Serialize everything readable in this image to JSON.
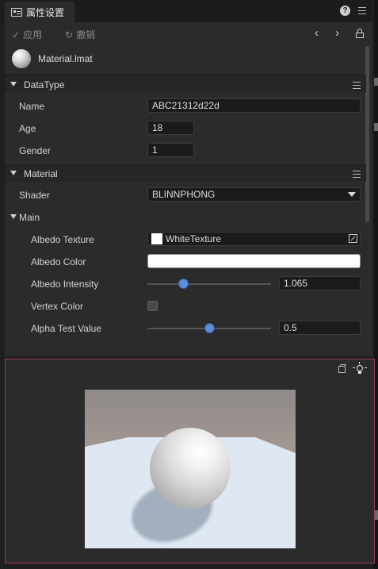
{
  "tabbar": {
    "tab_title": "属性设置"
  },
  "toolbar": {
    "apply_label": "应用",
    "revert_label": "撤销"
  },
  "asset": {
    "name": "Material.lmat"
  },
  "sections": {
    "datatype": {
      "title": "DataType",
      "fields": {
        "name": {
          "label": "Name",
          "value": "ABC21312d22d"
        },
        "age": {
          "label": "Age",
          "value": "18"
        },
        "gender": {
          "label": "Gender",
          "value": "1"
        }
      }
    },
    "material": {
      "title": "Material",
      "shader": {
        "label": "Shader",
        "value": "BLINNPHONG"
      },
      "main": {
        "title": "Main",
        "albedo_texture": {
          "label": "Albedo Texture",
          "value": "WhiteTexture"
        },
        "albedo_color": {
          "label": "Albedo Color",
          "value": "#ffffff"
        },
        "albedo_intensity": {
          "label": "Albedo Intensity",
          "value": "1.065",
          "slider_fraction": 0.29
        },
        "vertex_color": {
          "label": "Vertex Color",
          "checked": false
        },
        "alpha_test": {
          "label": "Alpha Test Value",
          "value": "0.5",
          "slider_fraction": 0.5
        }
      }
    }
  },
  "colors": {
    "accent": "#5b8ed6",
    "preview_border": "#9b3d4a",
    "panel_bg": "#2b2b2b"
  },
  "icons": [
    "panel-icon",
    "help-icon",
    "menu-icon",
    "check-icon",
    "revert-icon",
    "chevron-left-icon",
    "chevron-right-icon",
    "lock-icon",
    "material-sphere-icon",
    "eyedropper-icon",
    "cube-icon",
    "light-bulb-icon"
  ]
}
